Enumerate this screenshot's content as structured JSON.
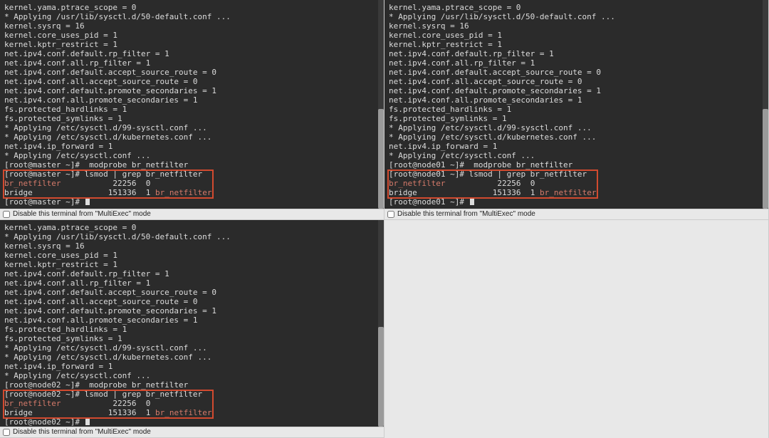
{
  "checkbox_label": "Disable this terminal from \"MultiExec\" mode",
  "sysctl_block": [
    "kernel.yama.ptrace_scope = 0",
    "* Applying /usr/lib/sysctl.d/50-default.conf ...",
    "kernel.sysrq = 16",
    "kernel.core_uses_pid = 1",
    "kernel.kptr_restrict = 1",
    "net.ipv4.conf.default.rp_filter = 1",
    "net.ipv4.conf.all.rp_filter = 1",
    "net.ipv4.conf.default.accept_source_route = 0",
    "net.ipv4.conf.all.accept_source_route = 0",
    "net.ipv4.conf.default.promote_secondaries = 1",
    "net.ipv4.conf.all.promote_secondaries = 1",
    "fs.protected_hardlinks = 1",
    "fs.protected_symlinks = 1",
    "* Applying /etc/sysctl.d/99-sysctl.conf ...",
    "* Applying /etc/sysctl.d/kubernetes.conf ...",
    "net.ipv4.ip_forward = 1",
    "* Applying /etc/sysctl.conf ..."
  ],
  "modprobe_cmd": "modprobe br_netfilter",
  "lsmod_cmd": "lsmod | grep br_netfilter",
  "lsmod_rows": [
    {
      "mod": "br_netfilter",
      "size": "22256",
      "used": "0",
      "by": ""
    },
    {
      "mod": "bridge",
      "size": "151336",
      "used": "1",
      "by": "br_netfilter"
    }
  ],
  "panes": [
    {
      "host": "master",
      "prompt": "[root@master ~]#"
    },
    {
      "host": "node01",
      "prompt": "[root@node01 ~]#"
    },
    {
      "host": "node02",
      "prompt": "[root@node02 ~]#"
    }
  ]
}
